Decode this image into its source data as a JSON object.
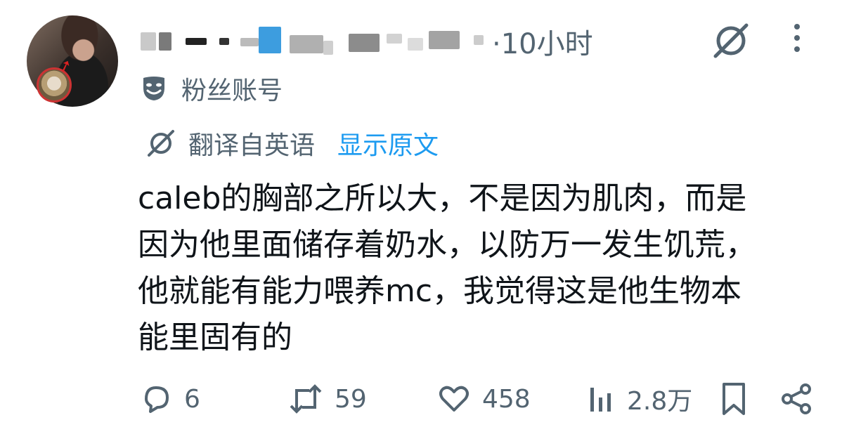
{
  "post": {
    "time": "10小时",
    "label": "粉丝账号",
    "translated_from": "翻译自英语",
    "show_original": "显示原文",
    "text": "caleb的胸部之所以大，不是因为肌肉，而是\n因为他里面储存着奶水，以防万一发生饥荒，\n他就能有能力喂养mc，我觉得这是他生物本\n能里固有的"
  },
  "actions": {
    "replies": "6",
    "reposts": "59",
    "likes": "458",
    "views": "2.8万"
  },
  "icons": {
    "grok": "grok-icon",
    "more": "more-vertical-icon",
    "fan": "theater-mask-icon",
    "translate": "grok-translate-icon",
    "reply": "comment-icon",
    "repost": "repost-icon",
    "like": "heart-icon",
    "views": "views-bar-chart-icon",
    "bookmark": "bookmark-icon",
    "share": "share-icon"
  },
  "colors": {
    "text": "#0f1419",
    "muted": "#536471",
    "link": "#1d9bf0"
  }
}
